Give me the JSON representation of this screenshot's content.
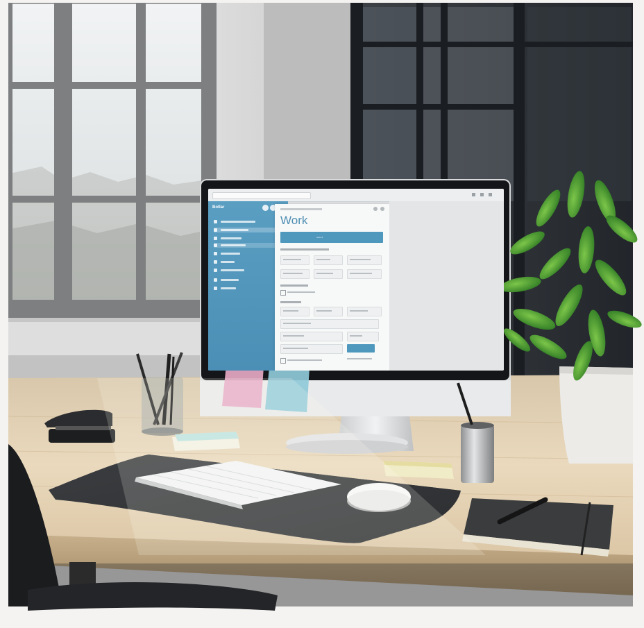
{
  "monitor": {
    "app_logo": "Botlar",
    "page_title": "Work",
    "primary_button": "Submit",
    "colors": {
      "sidebar": "#5a9ec2",
      "accent": "#4e97bd",
      "panel": "#f7f8f8"
    }
  },
  "desk_objects": [
    "pencil-cup",
    "stapler",
    "sticky-notes-pink",
    "sticky-notes-blue",
    "keyboard",
    "mouse",
    "desk-mat",
    "notebook",
    "pen",
    "metal-pen-cup",
    "potted-plant",
    "office-chair"
  ]
}
